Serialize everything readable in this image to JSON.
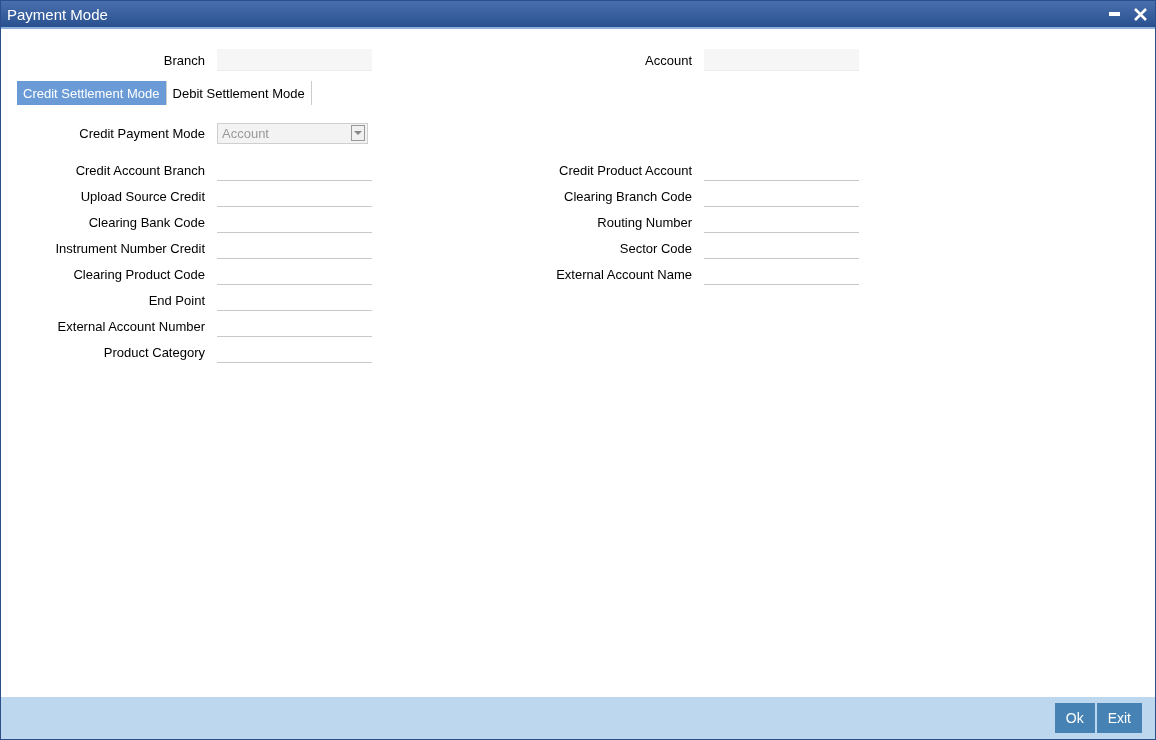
{
  "window": {
    "title": "Payment Mode"
  },
  "header_fields": [
    {
      "label": "Branch"
    },
    {
      "label": "Account"
    }
  ],
  "tabs": [
    {
      "label": "Credit Settlement Mode",
      "selected": true
    },
    {
      "label": "Debit Settlement Mode",
      "selected": false
    }
  ],
  "credit_payment_mode": {
    "label": "Credit Payment Mode",
    "value": "Account",
    "disabled": true
  },
  "left_fields": [
    {
      "label": "Credit Account Branch"
    },
    {
      "label": "Upload Source Credit"
    },
    {
      "label": "Clearing Bank Code"
    },
    {
      "label": "Instrument Number Credit"
    },
    {
      "label": "Clearing Product Code"
    },
    {
      "label": "End Point"
    },
    {
      "label": "External Account Number"
    },
    {
      "label": "Product Category"
    }
  ],
  "right_fields": [
    {
      "label": "Credit Product Account"
    },
    {
      "label": "Clearing Branch Code"
    },
    {
      "label": "Routing Number"
    },
    {
      "label": "Sector Code"
    },
    {
      "label": "External Account Name"
    }
  ],
  "buttons": [
    "Ok",
    "Exit"
  ]
}
